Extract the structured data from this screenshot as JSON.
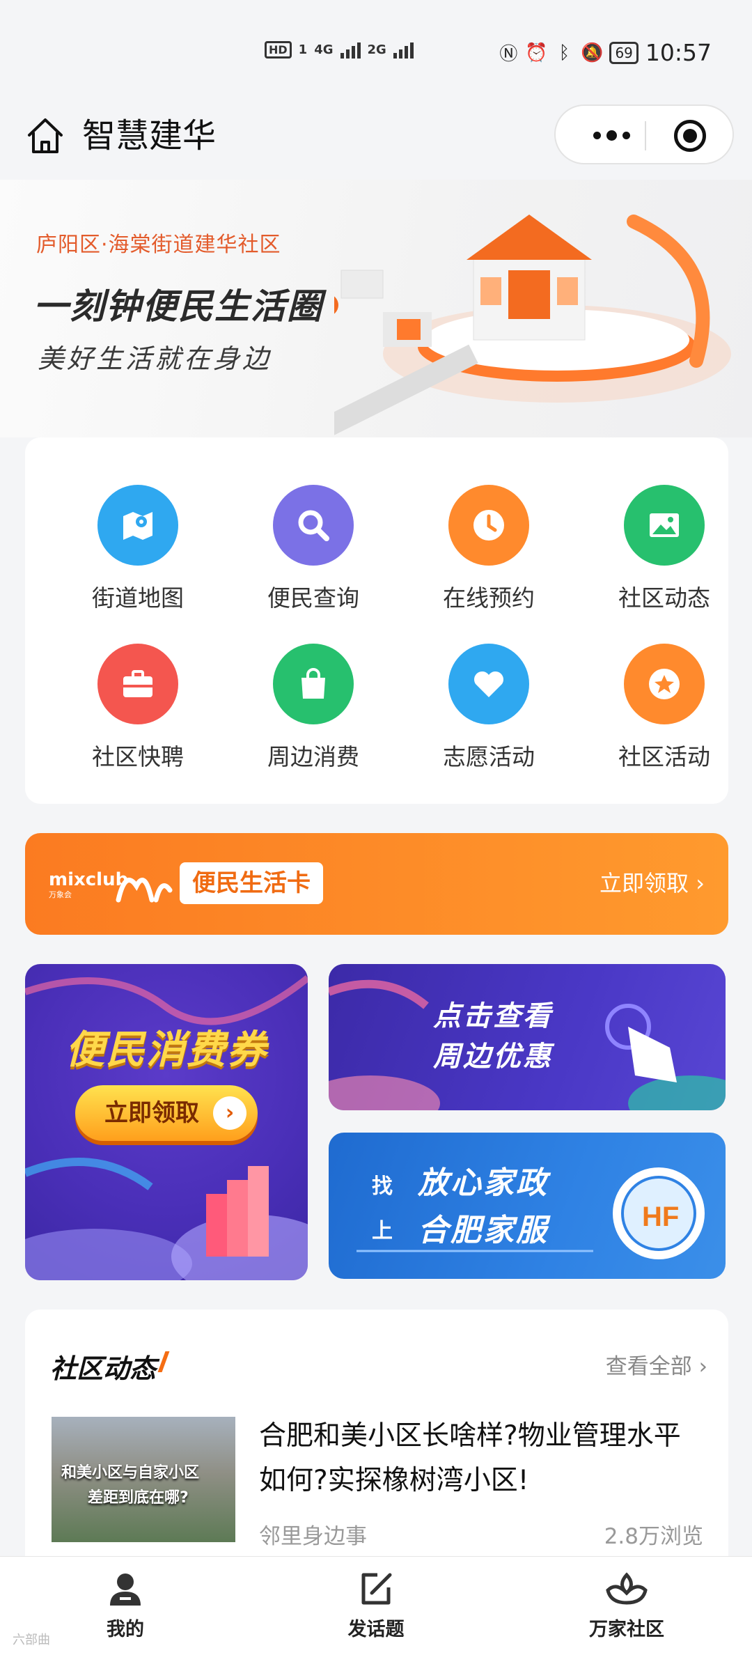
{
  "status_bar": {
    "hd": "HD",
    "sim1": "1",
    "net1": "4G",
    "net2": "2G",
    "battery": "69",
    "time": "10:57"
  },
  "header": {
    "title": "智慧建华"
  },
  "banner": {
    "subtitle": "庐阳区·海棠街道建华社区",
    "headline": "一刻钟便民生活圈",
    "slogan": "美好生活就在身边"
  },
  "services": [
    {
      "label": "街道地图",
      "icon": "map-icon",
      "color": "#2fa8f0"
    },
    {
      "label": "便民查询",
      "icon": "search-icon",
      "color": "#7b71e6"
    },
    {
      "label": "在线预约",
      "icon": "clock-icon",
      "color": "#ff8a2d"
    },
    {
      "label": "社区动态",
      "icon": "image-icon",
      "color": "#27c06e"
    },
    {
      "label": "社区快聘",
      "icon": "briefcase-icon",
      "color": "#f4564f"
    },
    {
      "label": "周边消费",
      "icon": "shopping-bag-icon",
      "color": "#27c06e"
    },
    {
      "label": "志愿活动",
      "icon": "heart-icon",
      "color": "#2fa8f0"
    },
    {
      "label": "社区活动",
      "icon": "star-icon",
      "color": "#ff8a2d"
    }
  ],
  "life_card": {
    "brand": "mixclub",
    "brand_sub": "万象会",
    "label": "便民生活卡",
    "cta": "立即领取 ›"
  },
  "promos": {
    "coupon_title": "便民消费券",
    "coupon_button": "立即领取",
    "deals_line1": "点击查看",
    "deals_line2": "周边优惠",
    "housekeeping_small1": "找",
    "housekeeping_small2": "上",
    "housekeeping_line1": "放心家政",
    "housekeeping_line2": "合肥家服"
  },
  "news": {
    "section_title": "社区动态",
    "see_all": "查看全部 ›",
    "thumb_caption1": "和美小区与自家小区",
    "thumb_caption2": "差距到底在哪?",
    "headline": "合肥和美小区长啥样?物业管理水平如何?实探橡树湾小区!",
    "category": "邻里身边事",
    "views": "2.8万浏览"
  },
  "tabbar": [
    {
      "label": "我的",
      "icon": "user-icon"
    },
    {
      "label": "发话题",
      "icon": "compose-icon"
    },
    {
      "label": "万家社区",
      "icon": "community-logo-icon"
    }
  ],
  "watermark": "六部曲"
}
